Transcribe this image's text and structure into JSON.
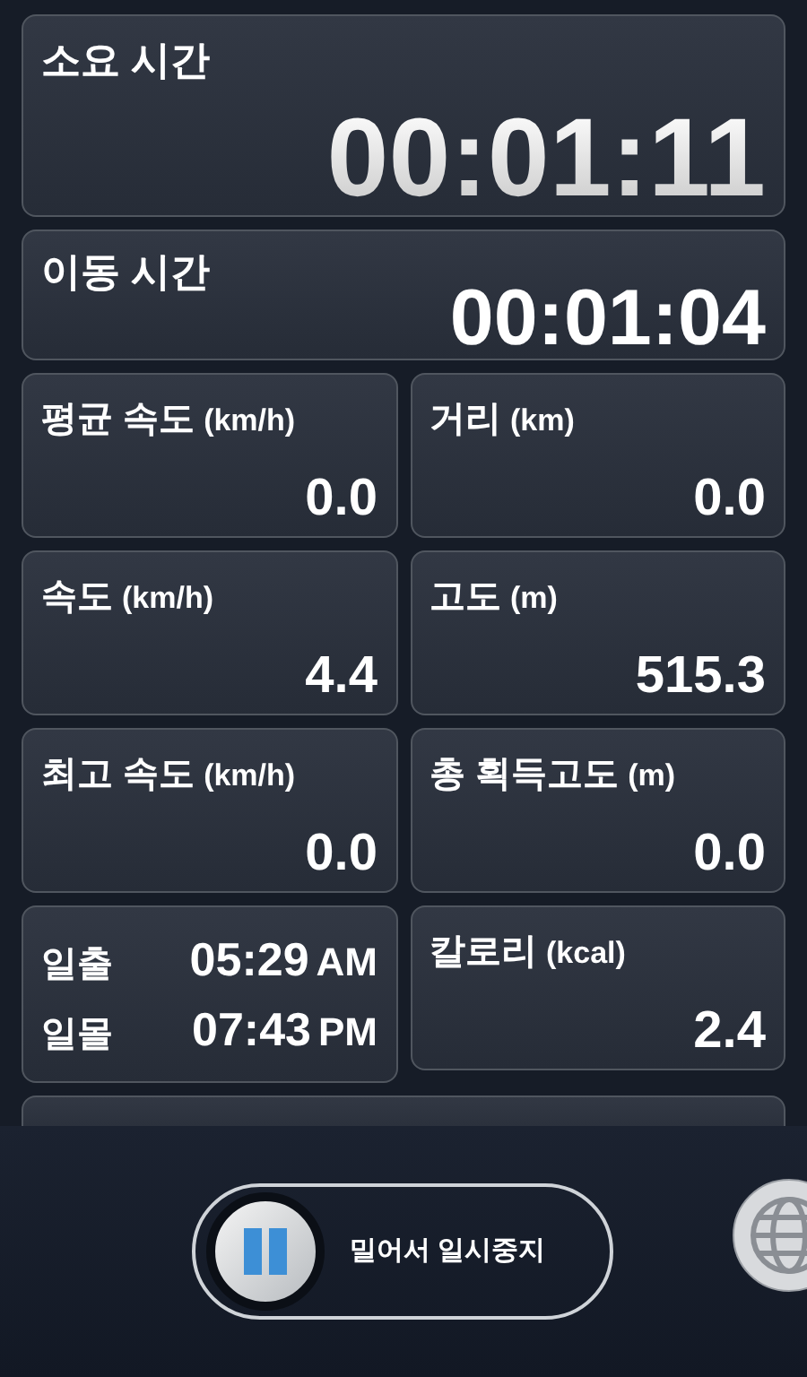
{
  "elapsed": {
    "label": "소요 시간",
    "value": "00:01:11"
  },
  "moving": {
    "label": "이동 시간",
    "value": "00:01:04"
  },
  "stats": [
    {
      "kind": "stat",
      "label": "평균 속도",
      "unit": "(km/h)",
      "value": "0.0"
    },
    {
      "kind": "stat",
      "label": "거리",
      "unit": "(km)",
      "value": "0.0"
    },
    {
      "kind": "stat",
      "label": "속도",
      "unit": "(km/h)",
      "value": "4.4"
    },
    {
      "kind": "stat",
      "label": "고도",
      "unit": "(m)",
      "value": "515.3"
    },
    {
      "kind": "stat",
      "label": "최고 속도",
      "unit": "(km/h)",
      "value": "0.0"
    },
    {
      "kind": "stat",
      "label": "총 획득고도",
      "unit": "(m)",
      "value": "0.0"
    },
    {
      "kind": "sun",
      "rows": [
        {
          "label": "일출",
          "time": "05:29",
          "suffix": "AM"
        },
        {
          "label": "일몰",
          "time": "07:43",
          "suffix": "PM"
        }
      ]
    },
    {
      "kind": "stat",
      "label": "칼로리",
      "unit": "(kcal)",
      "value": "2.4"
    }
  ],
  "slider": {
    "label": "밀어서 일시중지"
  }
}
